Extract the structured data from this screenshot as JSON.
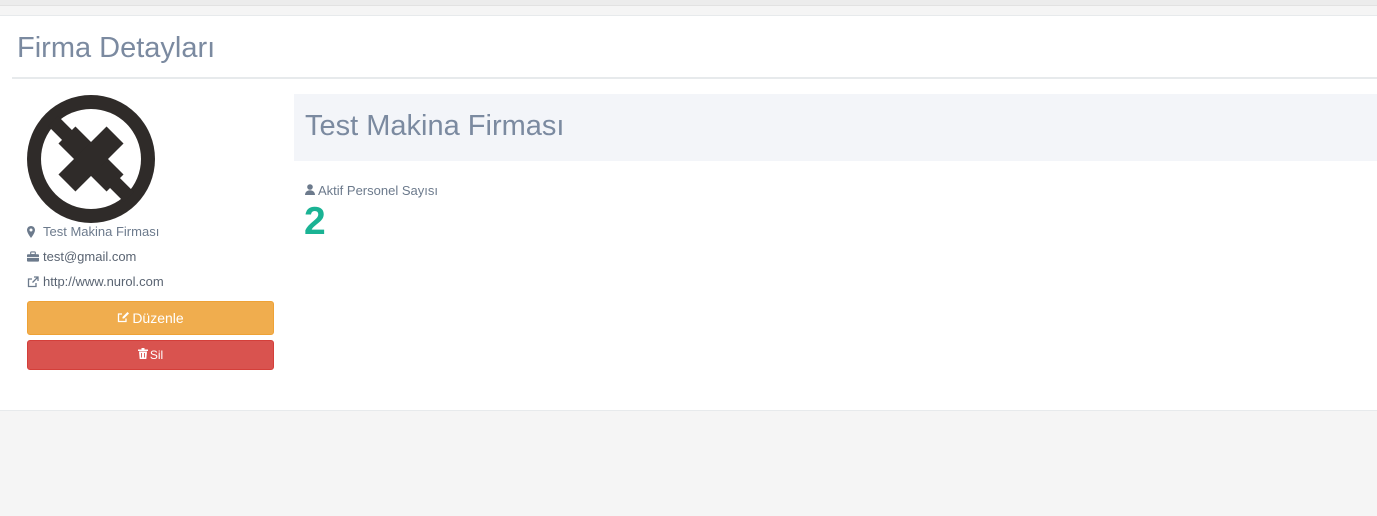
{
  "page": {
    "title": "Firma Detayları"
  },
  "company": {
    "name": "Test Makina Firması",
    "location": "Test Makina Firması",
    "email": "test@gmail.com",
    "website": "http://www.nurol.com"
  },
  "actions": {
    "edit_label": "Düzenle",
    "delete_label": "Sil"
  },
  "stats": {
    "active_staff_label": "Aktif Personel Sayısı",
    "active_staff_value": "2"
  },
  "icons": {
    "logo": "company-logo",
    "location": "map-marker-icon",
    "email": "briefcase-icon",
    "website": "external-link-icon",
    "edit": "edit-icon",
    "delete": "trash-icon",
    "staff": "user-icon"
  },
  "colors": {
    "edit_button": "#f0ad4e",
    "delete_button": "#d9534f",
    "stat_value": "#1ab394",
    "title": "#7b8aa0"
  }
}
